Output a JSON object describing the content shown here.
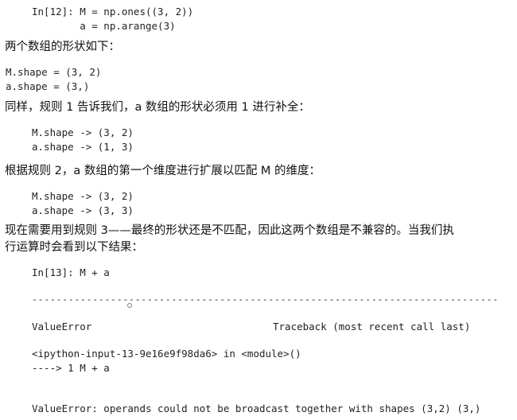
{
  "in12": {
    "line1": "In[12]: M = np.ones((3, 2))",
    "line2": "        a = np.arange(3)"
  },
  "para1": "两个数组的形状如下：",
  "shape_block1": {
    "line1": "M.shape = (3, 2)",
    "line2": "a.shape = (3,)"
  },
  "para2": "同样，规则 1 告诉我们，a 数组的形状必须用 1 进行补全：",
  "shape_block2": {
    "line1": "M.shape -> (3, 2)",
    "line2": "a.shape -> (1, 3)"
  },
  "para3": "根据规则 2，a 数组的第一个维度进行扩展以匹配 M 的维度：",
  "shape_block3": {
    "line1": "M.shape -> (3, 2)",
    "line2": "a.shape -> (3, 3)"
  },
  "para4_line1": "现在需要用到规则 3——最终的形状还是不匹配，因此这两个数组是不兼容的。当我们执",
  "para4_line2": "行运算时会看到以下结果：",
  "in13": "In[13]: M + a",
  "traceback": {
    "dashes": "-----------------------------------------------------------------------------",
    "error_name": "ValueError",
    "traceback_header": "Traceback (most recent call last)",
    "input_location": "<ipython-input-13-9e16e9f98da6> in <module>()",
    "arrow_line": "----> 1 M + a",
    "error_message": "ValueError: operands could not be broadcast together with shapes (3,2) (3,)"
  }
}
